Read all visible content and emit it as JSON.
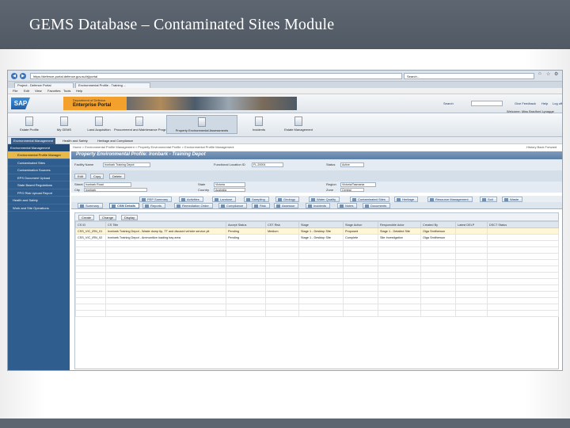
{
  "slide": {
    "title": "GEMS Database – Contaminated Sites Module"
  },
  "browser": {
    "address": "https://defence-portal.defence.gov.au/irj/portal",
    "search_placeholder": "Search...",
    "tabs": [
      "Project - Defence Portal",
      "Environmental Profile - Training ..."
    ],
    "menu": [
      "File",
      "Edit",
      "View",
      "Favorites",
      "Tools",
      "Help"
    ]
  },
  "portal": {
    "department": "Department of Defence",
    "portal_name": "Enterprise Portal",
    "search_label": "Search",
    "links": [
      "Give Feedback",
      "Help",
      "Log off"
    ],
    "welcome": "Welcome: Miss Bradford Lynagge",
    "nav_items": [
      "Estate Profile",
      "My GEMS",
      "Land Acquisition",
      "Procurement and Maintenance Programme",
      "Property Environmental Assessments",
      "Incidents",
      "Estate Management"
    ],
    "active_nav_index": 4,
    "sub_tabs": [
      "Environmental Management",
      "Health and Safety",
      "Heritage and Compliance"
    ],
    "active_sub_tab_index": 0
  },
  "sidebar": {
    "header": "Environmental Management",
    "items": [
      {
        "label": "Environmental Profile Manager",
        "sub": true
      },
      {
        "label": "Contaminated Sites",
        "sub": true
      },
      {
        "label": "Contamination Sources",
        "sub": true
      },
      {
        "label": "EPS Document Upload",
        "sub": true
      },
      {
        "label": "State Based Regulations",
        "sub": true
      },
      {
        "label": "PFG Risk Upload Report",
        "sub": true
      },
      {
        "label": "Health and Safety",
        "sub": false
      },
      {
        "label": "Work and Site Operations",
        "sub": false
      }
    ],
    "active_index": 0
  },
  "content": {
    "breadcrumb": "Home > Environmental Profile Management > Property Environmental Profile > Environmental Profile Management",
    "controls": "History  Back  Forward",
    "profile_title": "Property Environmental Profile: Ironbark - Training Depot",
    "form": {
      "facility_name_label": "Facility Name",
      "facility_name": "Ironbark Training Depot",
      "facility_id_label": "Functional Location ID",
      "facility_id": "FL-20004",
      "status_label": "Status",
      "status": "Active"
    },
    "toolbar_buttons": [
      "Edit",
      "Copy",
      "Delete"
    ],
    "address": {
      "street_label": "Street",
      "street": "Ironbark Road",
      "city_label": "City",
      "city": "Ironbark",
      "state_label": "State",
      "state": "Victoria",
      "country_label": "Country",
      "country": "Australia",
      "region_label": "Region",
      "region": "Victoria/Tasmania",
      "zone_label": "Zone",
      "zone": "Central"
    },
    "tabs_row1": [
      "PEP Summary",
      "Activities",
      "Landuse",
      "Sampling",
      "Geology",
      "Water Quality",
      "Contaminated Sites",
      "Heritage",
      "Resource Management",
      "Soil",
      "Waste"
    ],
    "tabs_row2": [
      "Summary",
      "CSM Details",
      "Reports",
      "Remediation Order",
      "Compliance",
      "Risk",
      "Assessor",
      "Incidents",
      "Notes",
      "Documents"
    ],
    "active_tab_row2_index": 1,
    "grid_toolbar": [
      "Create",
      "Change",
      "Display"
    ],
    "table": {
      "columns": [
        "CS ID",
        "CS Title",
        "Accept Status",
        "CST Risk",
        "Stage",
        "Stage Action",
        "Responsible Actor",
        "Created By",
        "Latest DELP",
        "DSCT Status"
      ],
      "rows": [
        [
          "CSS_VIC_IRN_01",
          "Ironbark Training Depot - Waste dump tip, TT and disused vehicle service pit",
          "Pending",
          "Medium",
          "Stage 1 - Desktop Site",
          "Proposed",
          "Stage 1 - Detailed Site",
          "Olga Smitherson",
          "",
          ""
        ],
        [
          "CSS_VIC_IRN_02",
          "Ironbark Training Depot - Ammunition loading bay area",
          "Pending",
          "",
          "Stage 1 - Desktop Site",
          "Complete",
          "Site Investigation",
          "Olga Smitherson",
          "",
          ""
        ]
      ],
      "selected_row_index": 0
    }
  }
}
